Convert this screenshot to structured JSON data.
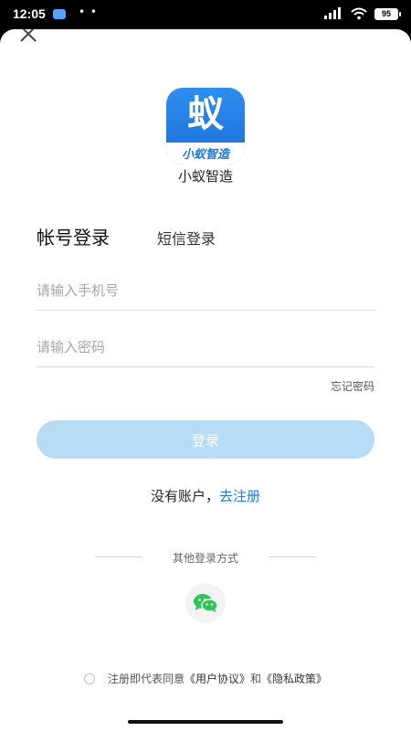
{
  "status": {
    "time": "12:05",
    "dots": "• •",
    "battery": "95"
  },
  "app": {
    "name": "小蚁智造",
    "logo_big": "蚁",
    "logo_small": "小蚁智造"
  },
  "tabs": {
    "active": "帐号登录",
    "inactive": "短信登录"
  },
  "form": {
    "phone_placeholder": "请输入手机号",
    "password_placeholder": "请输入密码",
    "forgot": "忘记密码",
    "login": "登录"
  },
  "register": {
    "prompt": "没有账户，",
    "link": "去注册"
  },
  "other_login": {
    "label": "其他登录方式"
  },
  "agreement": {
    "prefix": "注册即代表同意",
    "user_agreement": "《用户协议》",
    "and": "和",
    "privacy": "《隐私政策》"
  },
  "colors": {
    "accent": "#1f77d8",
    "login_btn": "#b6dcf6",
    "logo": "#2e8ef0",
    "wechat": "#2ec45a"
  }
}
